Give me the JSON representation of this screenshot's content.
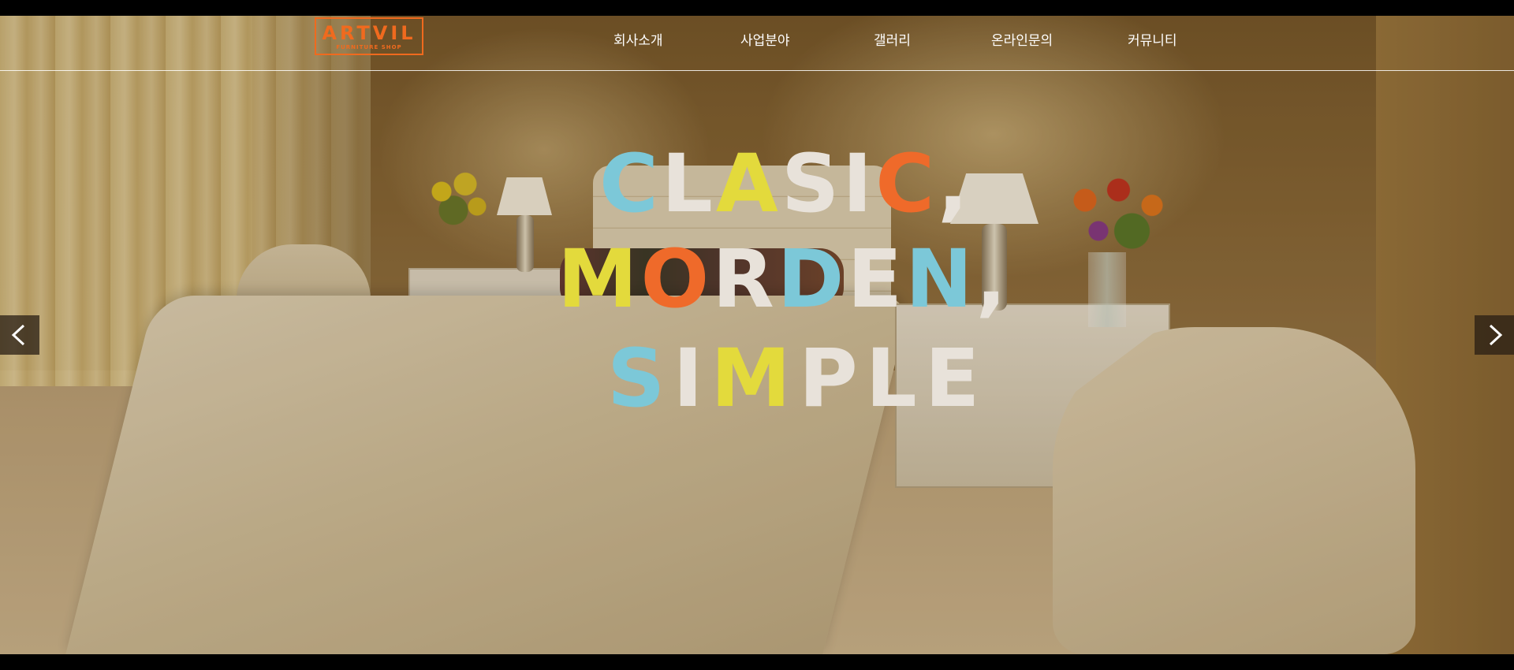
{
  "logo": {
    "title": "ARTVIL",
    "subtitle": "FURNITURE SHOP",
    "color": "#f06a1e"
  },
  "nav": {
    "items": [
      {
        "label": "회사소개"
      },
      {
        "label": "사업분야"
      },
      {
        "label": "갤러리"
      },
      {
        "label": "온라인문의"
      },
      {
        "label": "커뮤니티"
      }
    ]
  },
  "hero": {
    "line1": [
      {
        "char": "C",
        "color": "#7cc8d8"
      },
      {
        "char": "L",
        "color": "#e8e2da"
      },
      {
        "char": "A",
        "color": "#e3da3c"
      },
      {
        "char": "S",
        "color": "#e8e2da"
      },
      {
        "char": "I",
        "color": "#e8e2da"
      },
      {
        "char": "C",
        "color": "#ef6a2a"
      },
      {
        "char": ",",
        "color": "#e8e2da"
      }
    ],
    "line2": [
      {
        "char": "M",
        "color": "#e3da3c"
      },
      {
        "char": "O",
        "color": "#ef6a2a"
      },
      {
        "char": "R",
        "color": "#e8e2da"
      },
      {
        "char": "D",
        "color": "#7cc8d8"
      },
      {
        "char": "E",
        "color": "#e8e2da"
      },
      {
        "char": "N",
        "color": "#7cc8d8"
      },
      {
        "char": ",",
        "color": "#e8e2da"
      }
    ],
    "line3": [
      {
        "char": "S",
        "color": "#7cc8d8"
      },
      {
        "char": "I",
        "color": "#e8e2da"
      },
      {
        "char": "M",
        "color": "#e3da3c"
      },
      {
        "char": "P",
        "color": "#e8e2da"
      },
      {
        "char": "L",
        "color": "#e8e2da"
      },
      {
        "char": "E",
        "color": "#e8e2da"
      }
    ]
  },
  "slider": {
    "prev_icon": "chevron-left-icon",
    "next_icon": "chevron-right-icon"
  }
}
